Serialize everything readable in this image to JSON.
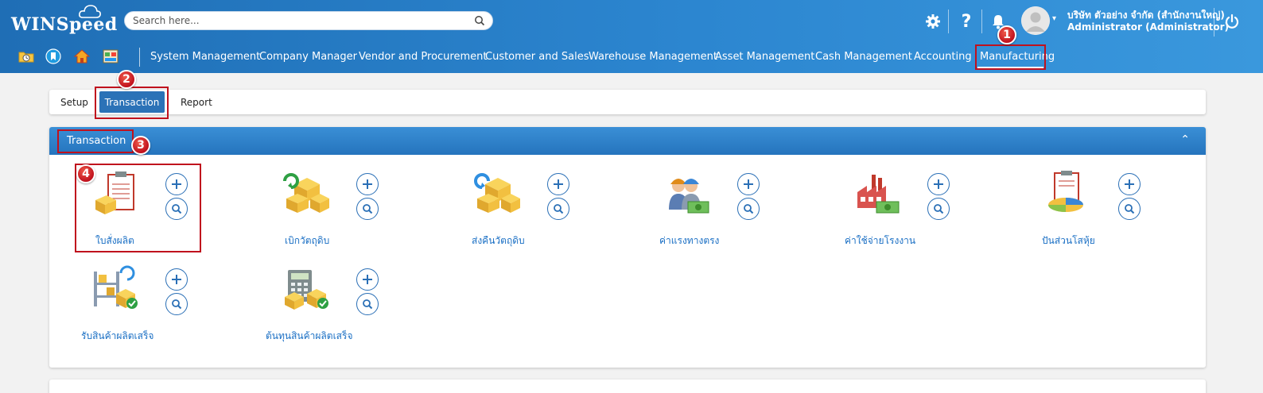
{
  "brand": {
    "logo_text": "WINSpeed"
  },
  "search": {
    "placeholder": "Search here..."
  },
  "header": {
    "help_label": "?",
    "company": "บริษัท ตัวอย่าง จำกัด (สำนักงานใหญ่)",
    "user": "Administrator (Administrator)"
  },
  "nav": {
    "items": [
      "System Management",
      "Company Manager",
      "Vendor and Procurement",
      "Customer and Sales",
      "Warehouse Management",
      "Asset Management",
      "Cash Management",
      "Accounting",
      "Manufacturing"
    ],
    "active": "Manufacturing"
  },
  "tabs": {
    "items": [
      "Setup",
      "Transaction",
      "Report"
    ],
    "active": "Transaction"
  },
  "panel": {
    "title": "Transaction",
    "collapse_glyph": "⌃"
  },
  "transactions": [
    "ใบสั่งผลิต",
    "เบิกวัตถุดิบ",
    "ส่งคืนวัตถุดิบ",
    "ค่าแรงทางตรง",
    "ค่าใช้จ่ายโรงงาน",
    "ปันส่วนโสหุ้ย",
    "รับสินค้าผลิตเสร็จ",
    "ต้นทุนสินค้าผลิตเสร็จ"
  ],
  "annotations": [
    "1",
    "2",
    "3",
    "4"
  ],
  "colors": {
    "header_blue": "#2c86d0",
    "highlight_red": "#c0111d",
    "link_blue": "#1a6fc4"
  }
}
